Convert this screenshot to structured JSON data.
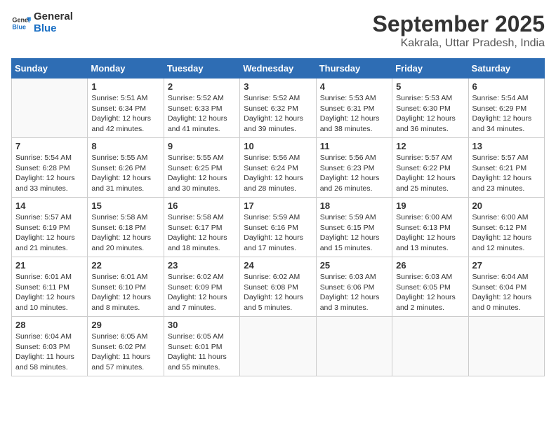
{
  "logo": {
    "line1": "General",
    "line2": "Blue"
  },
  "title": "September 2025",
  "subtitle": "Kakrala, Uttar Pradesh, India",
  "weekdays": [
    "Sunday",
    "Monday",
    "Tuesday",
    "Wednesday",
    "Thursday",
    "Friday",
    "Saturday"
  ],
  "weeks": [
    [
      {
        "day": "",
        "info": ""
      },
      {
        "day": "1",
        "info": "Sunrise: 5:51 AM\nSunset: 6:34 PM\nDaylight: 12 hours\nand 42 minutes."
      },
      {
        "day": "2",
        "info": "Sunrise: 5:52 AM\nSunset: 6:33 PM\nDaylight: 12 hours\nand 41 minutes."
      },
      {
        "day": "3",
        "info": "Sunrise: 5:52 AM\nSunset: 6:32 PM\nDaylight: 12 hours\nand 39 minutes."
      },
      {
        "day": "4",
        "info": "Sunrise: 5:53 AM\nSunset: 6:31 PM\nDaylight: 12 hours\nand 38 minutes."
      },
      {
        "day": "5",
        "info": "Sunrise: 5:53 AM\nSunset: 6:30 PM\nDaylight: 12 hours\nand 36 minutes."
      },
      {
        "day": "6",
        "info": "Sunrise: 5:54 AM\nSunset: 6:29 PM\nDaylight: 12 hours\nand 34 minutes."
      }
    ],
    [
      {
        "day": "7",
        "info": "Sunrise: 5:54 AM\nSunset: 6:28 PM\nDaylight: 12 hours\nand 33 minutes."
      },
      {
        "day": "8",
        "info": "Sunrise: 5:55 AM\nSunset: 6:26 PM\nDaylight: 12 hours\nand 31 minutes."
      },
      {
        "day": "9",
        "info": "Sunrise: 5:55 AM\nSunset: 6:25 PM\nDaylight: 12 hours\nand 30 minutes."
      },
      {
        "day": "10",
        "info": "Sunrise: 5:56 AM\nSunset: 6:24 PM\nDaylight: 12 hours\nand 28 minutes."
      },
      {
        "day": "11",
        "info": "Sunrise: 5:56 AM\nSunset: 6:23 PM\nDaylight: 12 hours\nand 26 minutes."
      },
      {
        "day": "12",
        "info": "Sunrise: 5:57 AM\nSunset: 6:22 PM\nDaylight: 12 hours\nand 25 minutes."
      },
      {
        "day": "13",
        "info": "Sunrise: 5:57 AM\nSunset: 6:21 PM\nDaylight: 12 hours\nand 23 minutes."
      }
    ],
    [
      {
        "day": "14",
        "info": "Sunrise: 5:57 AM\nSunset: 6:19 PM\nDaylight: 12 hours\nand 21 minutes."
      },
      {
        "day": "15",
        "info": "Sunrise: 5:58 AM\nSunset: 6:18 PM\nDaylight: 12 hours\nand 20 minutes."
      },
      {
        "day": "16",
        "info": "Sunrise: 5:58 AM\nSunset: 6:17 PM\nDaylight: 12 hours\nand 18 minutes."
      },
      {
        "day": "17",
        "info": "Sunrise: 5:59 AM\nSunset: 6:16 PM\nDaylight: 12 hours\nand 17 minutes."
      },
      {
        "day": "18",
        "info": "Sunrise: 5:59 AM\nSunset: 6:15 PM\nDaylight: 12 hours\nand 15 minutes."
      },
      {
        "day": "19",
        "info": "Sunrise: 6:00 AM\nSunset: 6:13 PM\nDaylight: 12 hours\nand 13 minutes."
      },
      {
        "day": "20",
        "info": "Sunrise: 6:00 AM\nSunset: 6:12 PM\nDaylight: 12 hours\nand 12 minutes."
      }
    ],
    [
      {
        "day": "21",
        "info": "Sunrise: 6:01 AM\nSunset: 6:11 PM\nDaylight: 12 hours\nand 10 minutes."
      },
      {
        "day": "22",
        "info": "Sunrise: 6:01 AM\nSunset: 6:10 PM\nDaylight: 12 hours\nand 8 minutes."
      },
      {
        "day": "23",
        "info": "Sunrise: 6:02 AM\nSunset: 6:09 PM\nDaylight: 12 hours\nand 7 minutes."
      },
      {
        "day": "24",
        "info": "Sunrise: 6:02 AM\nSunset: 6:08 PM\nDaylight: 12 hours\nand 5 minutes."
      },
      {
        "day": "25",
        "info": "Sunrise: 6:03 AM\nSunset: 6:06 PM\nDaylight: 12 hours\nand 3 minutes."
      },
      {
        "day": "26",
        "info": "Sunrise: 6:03 AM\nSunset: 6:05 PM\nDaylight: 12 hours\nand 2 minutes."
      },
      {
        "day": "27",
        "info": "Sunrise: 6:04 AM\nSunset: 6:04 PM\nDaylight: 12 hours\nand 0 minutes."
      }
    ],
    [
      {
        "day": "28",
        "info": "Sunrise: 6:04 AM\nSunset: 6:03 PM\nDaylight: 11 hours\nand 58 minutes."
      },
      {
        "day": "29",
        "info": "Sunrise: 6:05 AM\nSunset: 6:02 PM\nDaylight: 11 hours\nand 57 minutes."
      },
      {
        "day": "30",
        "info": "Sunrise: 6:05 AM\nSunset: 6:01 PM\nDaylight: 11 hours\nand 55 minutes."
      },
      {
        "day": "",
        "info": ""
      },
      {
        "day": "",
        "info": ""
      },
      {
        "day": "",
        "info": ""
      },
      {
        "day": "",
        "info": ""
      }
    ]
  ]
}
